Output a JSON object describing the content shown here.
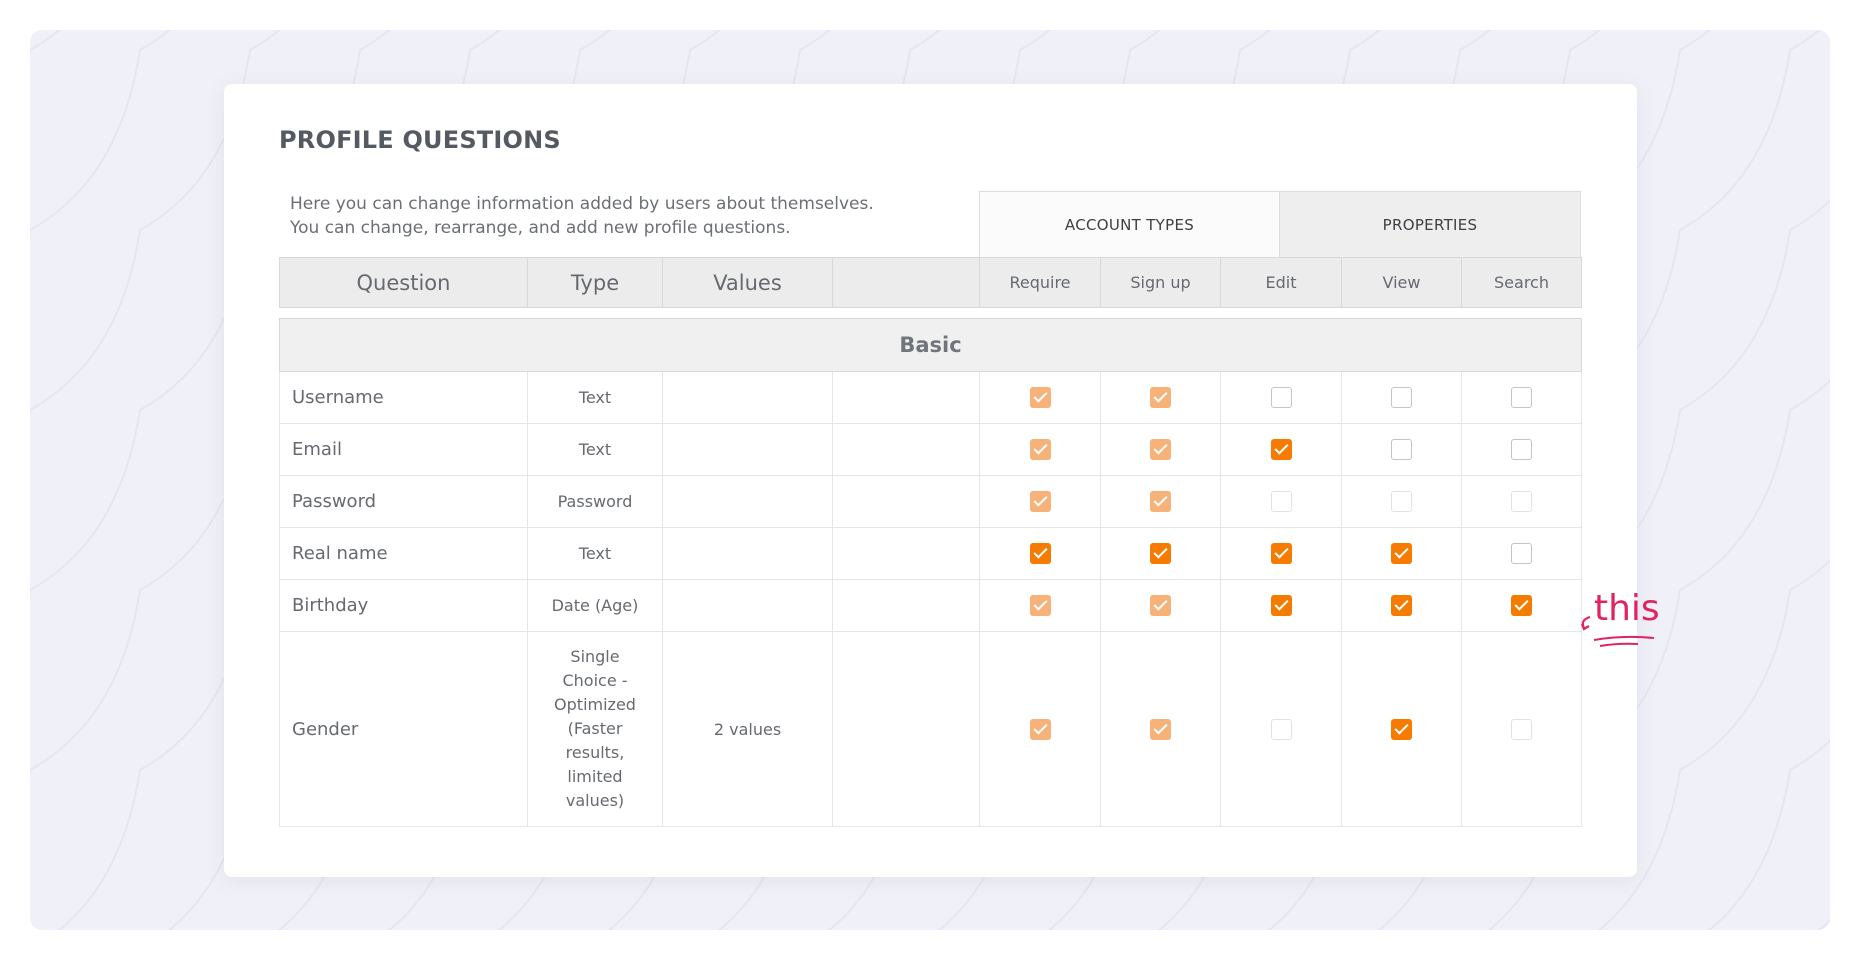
{
  "header": {
    "title": "PROFILE QUESTIONS"
  },
  "intro": {
    "line1": "Here you can change information added by users about themselves.",
    "line2": "You can change, rearrange, and add new profile questions."
  },
  "tabs": {
    "account_types": "ACCOUNT TYPES",
    "properties": "PROPERTIES"
  },
  "columns": {
    "question": "Question",
    "type": "Type",
    "values": "Values",
    "require": "Require",
    "signup": "Sign up",
    "edit": "Edit",
    "view": "View",
    "search": "Search"
  },
  "section": {
    "label": "Basic"
  },
  "rows": [
    {
      "question": "Username",
      "type": "Text",
      "values": "",
      "checks": {
        "require": "checked-disabled",
        "signup": "checked-disabled",
        "edit": "unchecked",
        "view": "unchecked",
        "search": "unchecked"
      }
    },
    {
      "question": "Email",
      "type": "Text",
      "values": "",
      "checks": {
        "require": "checked-disabled",
        "signup": "checked-disabled",
        "edit": "checked",
        "view": "unchecked",
        "search": "unchecked"
      }
    },
    {
      "question": "Password",
      "type": "Password",
      "values": "",
      "checks": {
        "require": "checked-disabled",
        "signup": "checked-disabled",
        "edit": "unchecked-disabled",
        "view": "unchecked-disabled",
        "search": "unchecked-disabled"
      }
    },
    {
      "question": "Real name",
      "type": "Text",
      "values": "",
      "checks": {
        "require": "checked",
        "signup": "checked",
        "edit": "checked",
        "view": "checked",
        "search": "unchecked"
      }
    },
    {
      "question": "Birthday",
      "type": "Date (Age)",
      "values": "",
      "checks": {
        "require": "checked-disabled",
        "signup": "checked-disabled",
        "edit": "checked",
        "view": "checked",
        "search": "checked"
      }
    },
    {
      "question": "Gender",
      "type": "Single Choice - Optimized (Faster results, limited values)",
      "values": "2 values",
      "checks": {
        "require": "checked-disabled",
        "signup": "checked-disabled",
        "edit": "unchecked-disabled",
        "view": "checked",
        "search": "unchecked-disabled"
      }
    }
  ],
  "annotation": {
    "text": "this",
    "color": "#e0245e"
  },
  "colors": {
    "accent": "#f57c00",
    "accent_disabled": "#f7b27a",
    "background": "#f0f0f8"
  }
}
